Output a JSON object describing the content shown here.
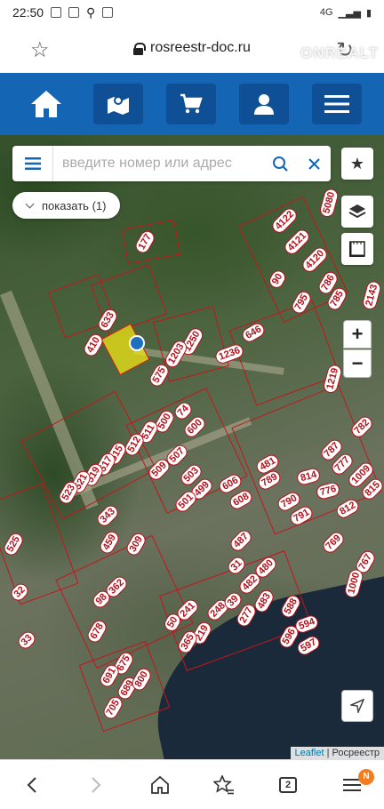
{
  "status_bar": {
    "time": "22:50",
    "network": "4G"
  },
  "browser": {
    "url": "rosreestr-doc.ru"
  },
  "watermark": "ONREALT",
  "search": {
    "placeholder": "введите номер или адрес"
  },
  "show_button": {
    "label": "показать (1)"
  },
  "map_controls": {
    "zoom_in": "+",
    "zoom_out": "−"
  },
  "attribution": {
    "leaflet": "Leaflet",
    "separator": "|",
    "source": "Росреестр"
  },
  "bottom_nav": {
    "tab_count": "2",
    "badge": "N"
  },
  "parcels": [
    {
      "label": "177"
    },
    {
      "label": "633"
    },
    {
      "label": "410"
    },
    {
      "label": "1250"
    },
    {
      "label": "1203"
    },
    {
      "label": "575"
    },
    {
      "label": "1236"
    },
    {
      "label": "646"
    },
    {
      "label": "4122"
    },
    {
      "label": "4121"
    },
    {
      "label": "4120"
    },
    {
      "label": "786"
    },
    {
      "label": "785"
    },
    {
      "label": "795"
    },
    {
      "label": "90"
    },
    {
      "label": "5080"
    },
    {
      "label": "2143"
    },
    {
      "label": "1219"
    },
    {
      "label": "782"
    },
    {
      "label": "74"
    },
    {
      "label": "600"
    },
    {
      "label": "500"
    },
    {
      "label": "511"
    },
    {
      "label": "512"
    },
    {
      "label": "515"
    },
    {
      "label": "517"
    },
    {
      "label": "519"
    },
    {
      "label": "521"
    },
    {
      "label": "523"
    },
    {
      "label": "509"
    },
    {
      "label": "507"
    },
    {
      "label": "503"
    },
    {
      "label": "499"
    },
    {
      "label": "501"
    },
    {
      "label": "481"
    },
    {
      "label": "789"
    },
    {
      "label": "814"
    },
    {
      "label": "787"
    },
    {
      "label": "777"
    },
    {
      "label": "776"
    },
    {
      "label": "1009"
    },
    {
      "label": "815"
    },
    {
      "label": "812"
    },
    {
      "label": "790"
    },
    {
      "label": "791"
    },
    {
      "label": "606"
    },
    {
      "label": "608"
    },
    {
      "label": "343"
    },
    {
      "label": "459"
    },
    {
      "label": "309"
    },
    {
      "label": "525"
    },
    {
      "label": "487"
    },
    {
      "label": "769"
    },
    {
      "label": "767"
    },
    {
      "label": "1000"
    },
    {
      "label": "31"
    },
    {
      "label": "480"
    },
    {
      "label": "482"
    },
    {
      "label": "483"
    },
    {
      "label": "32"
    },
    {
      "label": "98"
    },
    {
      "label": "362"
    },
    {
      "label": "241"
    },
    {
      "label": "50"
    },
    {
      "label": "248"
    },
    {
      "label": "39"
    },
    {
      "label": "277"
    },
    {
      "label": "588"
    },
    {
      "label": "594"
    },
    {
      "label": "596"
    },
    {
      "label": "597"
    },
    {
      "label": "33"
    },
    {
      "label": "678"
    },
    {
      "label": "219"
    },
    {
      "label": "365"
    },
    {
      "label": "675"
    },
    {
      "label": "691"
    },
    {
      "label": "689"
    },
    {
      "label": "800"
    },
    {
      "label": "705"
    }
  ]
}
